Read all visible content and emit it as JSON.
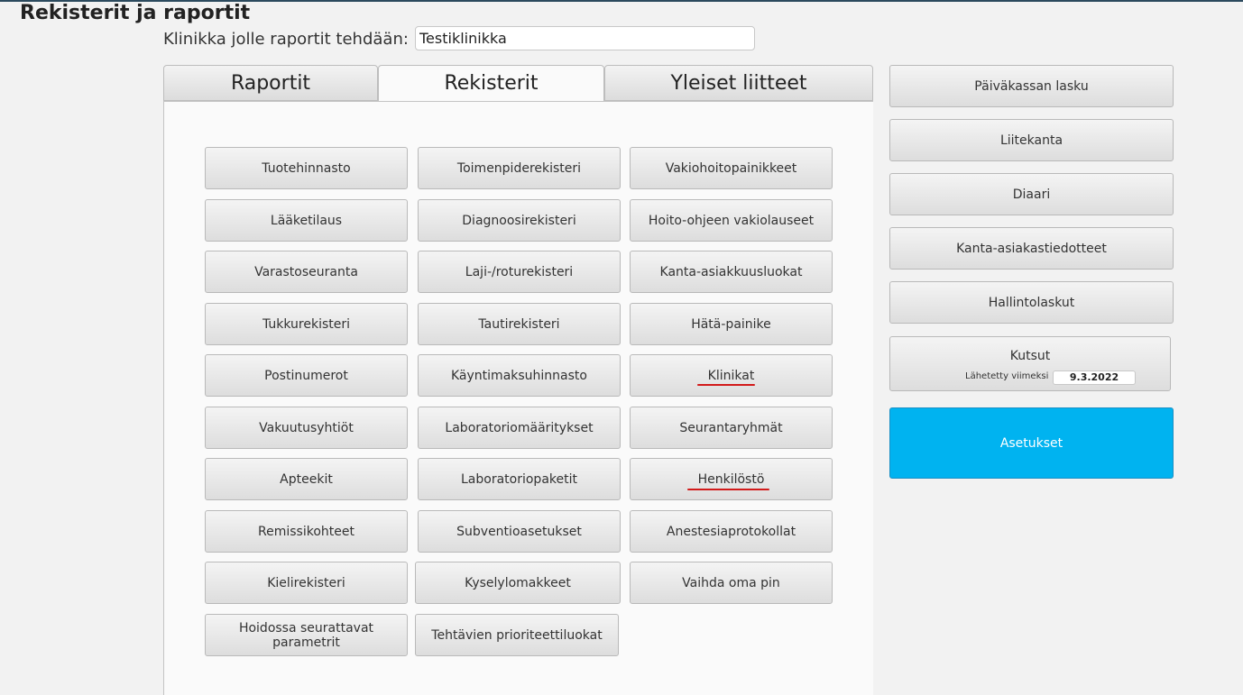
{
  "page": {
    "title": "Rekisterit ja raportit",
    "clinic_label": "Klinikka jolle raportit tehdään:",
    "clinic_value": "Testiklinikka"
  },
  "tabs": [
    {
      "label": "Raportit"
    },
    {
      "label": "Rekisterit",
      "active": true
    },
    {
      "label": "Yleiset liitteet"
    }
  ],
  "registers": {
    "col1": [
      "Tuotehinnasto",
      "Lääketilaus",
      "Varastoseuranta",
      "Tukkurekisteri",
      "Postinumerot",
      "Vakuutusyhtiöt",
      "Apteekit",
      "Remissikohteet",
      "Kielirekisteri",
      "Hoidossa seurattavat parametrit"
    ],
    "col2": [
      "Toimenpiderekisteri",
      "Diagnoosirekisteri",
      "Laji-/roturekisteri",
      "Tautirekisteri",
      "Käyntimaksuhinnasto",
      "Laboratoriomääritykset",
      "Laboratoriopaketit",
      "Subventioasetukset",
      "Kyselylomakkeet",
      "Tehtävien prioriteettiluokat"
    ],
    "col3": [
      "Vakiohoitopainikkeet",
      "Hoito-ohjeen vakiolauseet",
      "Kanta-asiakkuusluokat",
      "Hätä-painike",
      "Klinikat",
      "Seurantaryhmät",
      "Henkilöstö",
      "Anestesiaprotokollat",
      "Vaihda oma pin"
    ]
  },
  "sidebar": {
    "buttons": [
      "Päiväkassan lasku",
      "Liitekanta",
      "Diaari",
      "Kanta-asiakastiedotteet",
      "Hallintolaskut"
    ],
    "kutsut": {
      "title": "Kutsut",
      "sent_label": "Lähetetty viimeksi",
      "sent_date": "9.3.2022"
    },
    "settings_label": "Asetukset"
  },
  "colors": {
    "accent": "#00b3f0",
    "highlight_underline": "#d21a1a"
  }
}
